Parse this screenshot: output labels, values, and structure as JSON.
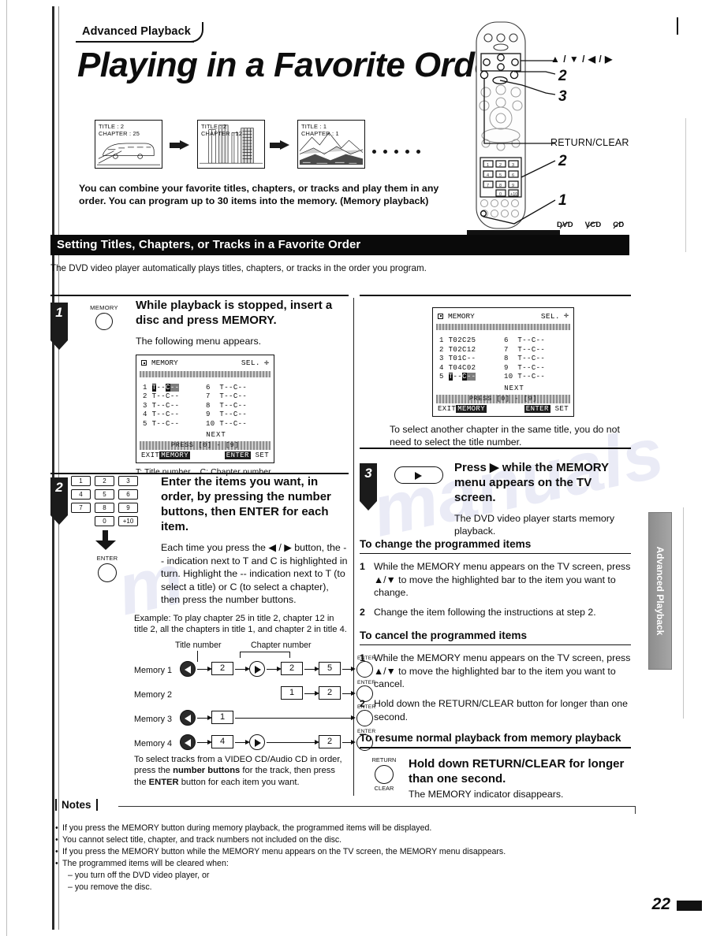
{
  "breadcrumb": "Advanced Playback",
  "title": "Playing in a Favorite Order",
  "screens": [
    {
      "title_line": "TITLE : 2",
      "chapter_line": "CHAPTER : 25",
      "art": "train"
    },
    {
      "title_line": "TITLE : 2",
      "chapter_line": "CHAPTER : 12",
      "art": "buildings"
    },
    {
      "title_line": "TITLE : 1",
      "chapter_line": "CHAPTER : 1",
      "art": "mountains"
    }
  ],
  "lede": "You can combine your favorite titles, chapters, or tracks and play them in any order. You can program up to 30 items into the memory. (Memory playback)",
  "remote": {
    "callout_arrows": "▲ / ▼ / ◀ / ▶",
    "callout_2a": "2",
    "callout_3": "3",
    "callout_return": "RETURN/CLEAR",
    "callout_2b": "2",
    "callout_1": "1",
    "badges": [
      "DVD",
      "VCD",
      "CD"
    ]
  },
  "section": {
    "bar_title": "Setting Titles, Chapters, or Tracks in a Favorite Order",
    "intro": "The DVD video player automatically plays titles, chapters, or tracks in the order you program."
  },
  "step1": {
    "number": "1",
    "icon_label": "MEMORY",
    "heading": "While playback is stopped, insert a disc and press MEMORY.",
    "body": "The following menu appears.",
    "caption_t": "T: Title number",
    "caption_c": "C: Chapter number"
  },
  "osd1": {
    "label": "MEMORY",
    "sel": "SEL.",
    "rows_left": [
      "1",
      "2",
      "3",
      "4",
      "5"
    ],
    "rows_left_values": [
      "T--C--",
      "T--C--",
      "T--C--",
      "T--C--",
      "T--C--"
    ],
    "rows_right": [
      "6",
      "7",
      "8",
      "9",
      "10"
    ],
    "rows_right_values": [
      "T--C--",
      "T--C--",
      "T--C--",
      "T--C--",
      "T--C--"
    ],
    "next": "NEXT",
    "press": "PRESS [0] - [9]",
    "exit": "EXIT",
    "exit_chip": "MEMORY",
    "enter_chip": "ENTER",
    "set": "SET",
    "highlight_row": 1
  },
  "osd2": {
    "label": "MEMORY",
    "sel": "SEL.",
    "rows_left": [
      "1",
      "2",
      "3",
      "4",
      "5"
    ],
    "rows_left_values": [
      "T02C25",
      "T02C12",
      "T01C--",
      "T04C02",
      "T--C--"
    ],
    "rows_right": [
      "6",
      "7",
      "8",
      "9",
      "10"
    ],
    "rows_right_values": [
      "T--C--",
      "T--C--",
      "T--C--",
      "T--C--",
      "T--C--"
    ],
    "next": "NEXT",
    "press": "PRESS [0] - [9]",
    "exit": "EXIT",
    "exit_chip": "MEMORY",
    "enter_chip": "ENTER",
    "set": "SET",
    "highlight_row": 5
  },
  "osd2_note": "To select another chapter in the same title, you do not need to select the title number.",
  "step2": {
    "number": "2",
    "keys": [
      "1",
      "2",
      "3",
      "4",
      "5",
      "6",
      "7",
      "8",
      "9",
      "0",
      "+10"
    ],
    "enter_label": "ENTER",
    "heading": "Enter the items you want, in order, by pressing the number buttons, then ENTER for each item.",
    "body": "Each time you press the ◀ / ▶ button, the -- indication next to T and C is highlighted in turn. Highlight the -- indication next to T (to select a title) or C (to select a chapter), then press the number buttons.",
    "example": "Example: To play chapter 25 in title 2, chapter 12 in title 2, all the chapters in title 1, and chapter 2 in title 4."
  },
  "sequence": {
    "title_number_label": "Title number",
    "chapter_number_label": "Chapter number",
    "enter_label": "ENTER",
    "rows": [
      {
        "label": "Memory 1",
        "title_key": "2",
        "chapter_keys": [
          "2",
          "5"
        ]
      },
      {
        "label": "Memory 2",
        "title_key": "",
        "chapter_keys": [
          "1",
          "2"
        ]
      },
      {
        "label": "Memory 3",
        "title_key": "1",
        "chapter_keys": []
      },
      {
        "label": "Memory 4",
        "title_key": "4",
        "chapter_keys": [
          "2"
        ]
      }
    ]
  },
  "track_note": {
    "part1": "To select tracks from a VIDEO CD/Audio CD in order, press the ",
    "bold1": "number buttons",
    "part2": " for the track, then press the ",
    "bold2": "ENTER",
    "part3": " button for each item you want."
  },
  "step3": {
    "number": "3",
    "heading": "Press ▶ while the MEMORY menu appears on the TV screen.",
    "body": "The DVD video player starts memory playback."
  },
  "change_section": {
    "heading": "To change the programmed items",
    "items": [
      {
        "n": "1",
        "text": "While the MEMORY menu appears on the TV screen, press ▲/▼ to move the highlighted bar to the item you want to change."
      },
      {
        "n": "2",
        "text": "Change the item following the instructions at step 2."
      }
    ]
  },
  "cancel_section": {
    "heading": "To cancel the programmed items",
    "items": [
      {
        "n": "1",
        "text": "While the MEMORY menu appears on the TV screen, press ▲/▼ to move the highlighted bar to the item you want to cancel."
      },
      {
        "n": "2",
        "text": "Hold down the RETURN/CLEAR button for longer than one second."
      }
    ]
  },
  "resume_section": {
    "heading": "To resume normal playback from memory playback",
    "icon_top": "RETURN",
    "icon_bottom": "CLEAR",
    "bold_text": "Hold down RETURN/CLEAR for longer than one second.",
    "body": "The MEMORY indicator disappears."
  },
  "notes": {
    "heading": "Notes",
    "items": [
      "If you press the MEMORY button during memory playback, the programmed items will be displayed.",
      "You cannot select title, chapter, and track numbers not included on the disc.",
      "If you press the MEMORY button while the MEMORY menu appears on the TV screen, the MEMORY menu disappears.",
      "The programmed items will be cleared when:"
    ],
    "sub_items": [
      "– you turn off the DVD video player, or",
      "– you remove the disc."
    ]
  },
  "side_tab": "Advanced Playback",
  "page_number": "22"
}
